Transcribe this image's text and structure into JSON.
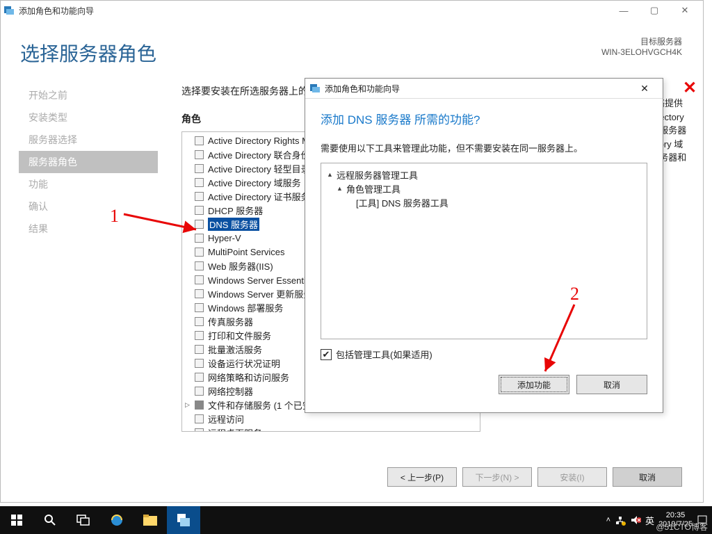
{
  "window": {
    "title": "添加角色和功能向导",
    "heading": "选择服务器角色",
    "target_label": "目标服务器",
    "target_value": "WIN-3ELOHVGCH4K"
  },
  "sidebar": {
    "items": [
      {
        "label": "开始之前"
      },
      {
        "label": "安装类型"
      },
      {
        "label": "服务器选择"
      },
      {
        "label": "服务器角色",
        "active": true
      },
      {
        "label": "功能"
      },
      {
        "label": "确认"
      },
      {
        "label": "结果"
      }
    ]
  },
  "roles": {
    "instruction": "选择要安装在所选服务器上的一个或多个角色。",
    "label": "角色",
    "items": [
      {
        "label": "Active Directory Rights Management Services"
      },
      {
        "label": "Active Directory 联合身份验证服务"
      },
      {
        "label": "Active Directory 轻型目录服务"
      },
      {
        "label": "Active Directory 域服务"
      },
      {
        "label": "Active Directory 证书服务"
      },
      {
        "label": "DHCP 服务器"
      },
      {
        "label": "DNS 服务器",
        "selected": true
      },
      {
        "label": "Hyper-V"
      },
      {
        "label": "MultiPoint Services"
      },
      {
        "label": "Web 服务器(IIS)"
      },
      {
        "label": "Windows Server Essentials 体验"
      },
      {
        "label": "Windows Server 更新服务"
      },
      {
        "label": "Windows 部署服务"
      },
      {
        "label": "传真服务器"
      },
      {
        "label": "打印和文件服务"
      },
      {
        "label": "批量激活服务"
      },
      {
        "label": "设备运行状况证明"
      },
      {
        "label": "网络策略和访问服务"
      },
      {
        "label": "网络控制器"
      },
      {
        "label": "文件和存储服务 (1 个已安装, 共 12 个)",
        "expandable": true,
        "shaded": true
      },
      {
        "label": "远程访问"
      },
      {
        "label": "远程桌面服务"
      }
    ]
  },
  "description": {
    "text": "域名系统(DNS)服务器为 TCP/IP 网络提供名称解析。DNS 服务器与 Active Directory 域服务安装在同一服务器上时, DNS 服务器更易于管理。如果选择 Active Directory 域服务角色,你可以安装并配置 DNS 服务器和 Active Directory 域服务一起工作。"
  },
  "modal": {
    "title": "添加角色和功能向导",
    "heading": "添加 DNS 服务器 所需的功能?",
    "sub": "需要使用以下工具来管理此功能，但不需要安装在同一服务器上。",
    "tree": {
      "l0": "远程服务器管理工具",
      "l1": "角色管理工具",
      "l2": "[工具] DNS 服务器工具"
    },
    "include_label": "包括管理工具(如果适用)",
    "add_btn": "添加功能",
    "cancel_btn": "取消"
  },
  "buttons": {
    "prev": "< 上一步(P)",
    "next": "下一步(N) >",
    "install": "安装(I)",
    "cancel": "取消"
  },
  "annotations": {
    "one": "1",
    "two": "2"
  },
  "taskbar": {
    "ime": "英",
    "time_line1": "20:35",
    "time_line2": "2019/7/25"
  },
  "watermark": "@51CTO博客"
}
